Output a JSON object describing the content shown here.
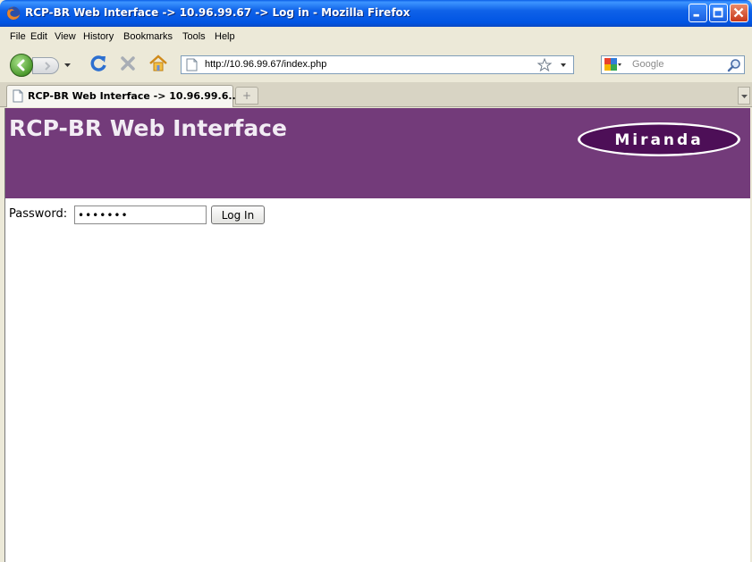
{
  "window": {
    "title": "RCP-BR Web Interface -> 10.96.99.67 -> Log in - Mozilla Firefox"
  },
  "menu": {
    "items": [
      "File",
      "Edit",
      "View",
      "History",
      "Bookmarks",
      "Tools",
      "Help"
    ]
  },
  "nav": {
    "url": "http://10.96.99.67/index.php",
    "search_placeholder": "Google"
  },
  "tabs": {
    "active_label": "RCP-BR Web Interface -> 10.96.99.6...",
    "new_tab_label": "+"
  },
  "page": {
    "banner_title": "RCP-BR Web Interface",
    "logo_text": "Miranda",
    "password_label": "Password:",
    "password_value": "•••••••",
    "login_button": "Log In"
  },
  "colors": {
    "banner": "#733b7a",
    "titlebar": "#0054e3"
  }
}
